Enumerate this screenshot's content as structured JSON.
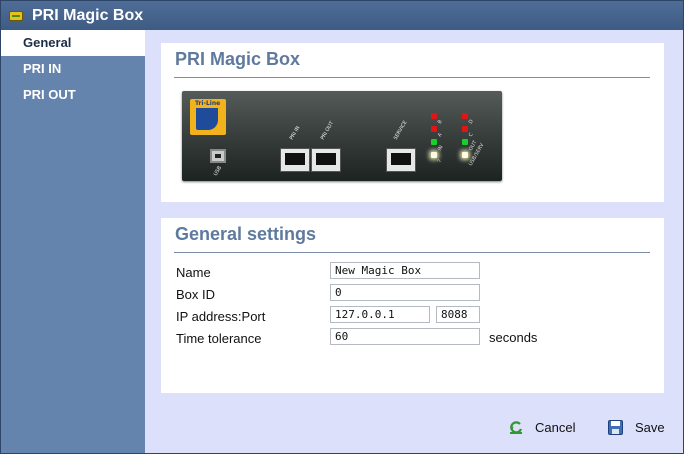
{
  "window": {
    "title": "PRI Magic Box"
  },
  "sidebar": {
    "items": [
      {
        "label": "General"
      },
      {
        "label": "PRI IN"
      },
      {
        "label": "PRI OUT"
      }
    ]
  },
  "device_panel": {
    "title": "PRI Magic Box",
    "image": {
      "logo_text": "Tri-Line",
      "labels": {
        "usb": "USB",
        "pri_in": "PRI IN",
        "pri_out": "PRI OUT",
        "service": "SERVICE"
      },
      "led_labels": [
        "B",
        "A",
        "IN",
        "?",
        "D",
        "C",
        "OUT",
        "USB/SERV"
      ]
    }
  },
  "settings": {
    "title": "General settings",
    "name_label": "Name",
    "name_value": "New Magic Box",
    "boxid_label": "Box ID",
    "boxid_value": "0",
    "ip_label": "IP address:Port",
    "ip_value": "127.0.0.1",
    "port_value": "8088",
    "time_label": "Time tolerance",
    "time_value": "60",
    "time_suffix": "seconds"
  },
  "actions": {
    "cancel_label": "Cancel",
    "save_label": "Save"
  },
  "colors": {
    "titlebar": "#4f6d97",
    "sidebar": "#6584ad",
    "background": "#dde0fa",
    "heading": "#5f7a9e"
  }
}
